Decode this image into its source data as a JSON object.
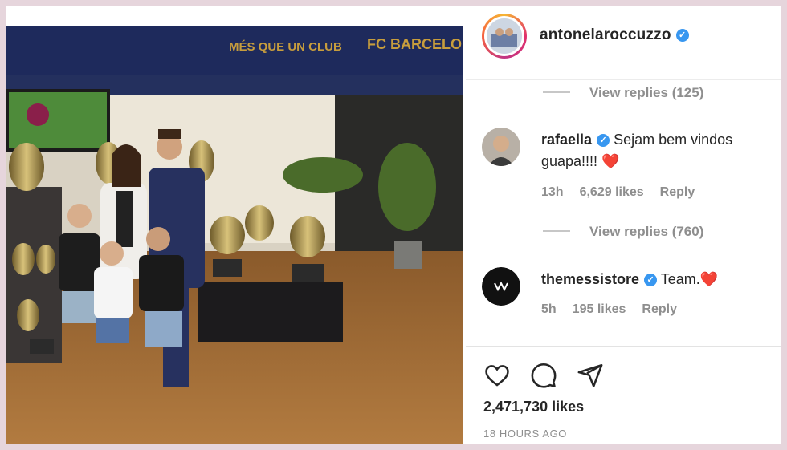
{
  "post": {
    "banner_left": "MÉS QUE UN CLUB",
    "banner_right": "FC BARCELONA"
  },
  "header": {
    "username": "antonelaroccuzzo",
    "verified_mark": "✓"
  },
  "comments": {
    "view_replies_1": "View replies (125)",
    "view_replies_2": "View replies (760)",
    "items": [
      {
        "username": "rafaella",
        "verified_mark": "✓",
        "text": "Sejam bem vindos guapa!!!! ",
        "emoji": "❤️",
        "age": "13h",
        "likes": "6,629 likes",
        "reply": "Reply"
      },
      {
        "username": "themessistore",
        "verified_mark": "✓",
        "text": "Team.",
        "emoji": "❤️",
        "age": "5h",
        "likes": "195 likes",
        "reply": "Reply"
      }
    ]
  },
  "footer": {
    "likes": "2,471,730 likes",
    "timestamp": "18 HOURS AGO",
    "icons": [
      "heart-icon",
      "comment-icon",
      "share-icon"
    ]
  },
  "colors": {
    "verified": "#3897f0",
    "heart": "#ed2027",
    "muted": "#8e8e8e",
    "frame": "#e6d5dc"
  }
}
